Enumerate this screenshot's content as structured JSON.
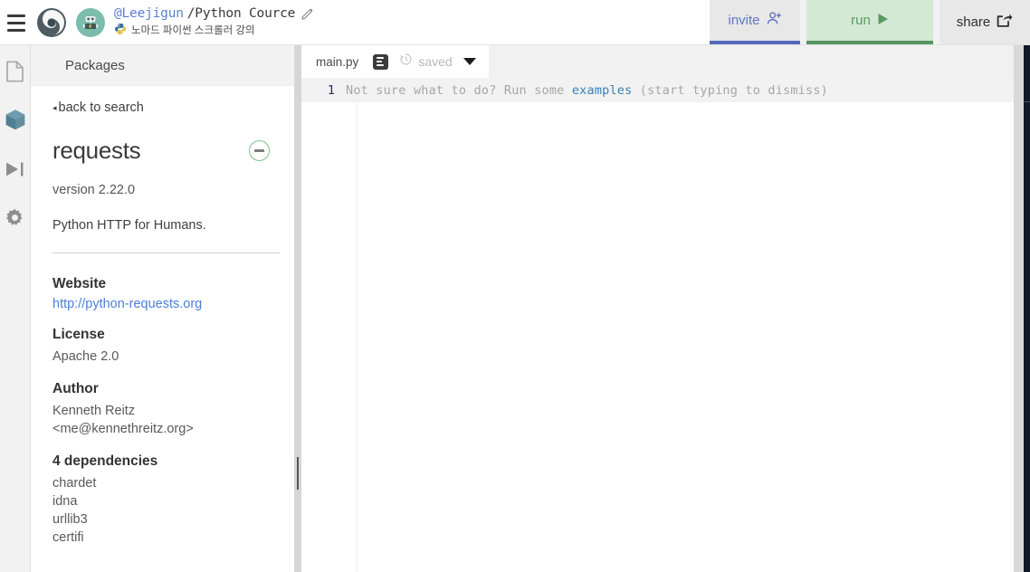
{
  "header": {
    "menu_icon": "hamburger-menu-icon",
    "logo_icon": "replit-logo-icon",
    "avatar_icon": "robot-avatar-icon",
    "owner": "@Leejigun",
    "repl_name": "/Python Cource",
    "edit_icon": "pencil-icon",
    "subtitle_icon": "python-logo-icon",
    "subtitle": "노마드 파이썬 스크롤러 강의",
    "buttons": {
      "invite": {
        "label": "invite",
        "icon": "add-person-icon",
        "accent": "#5568b8",
        "bg": "#e8e8e8"
      },
      "run": {
        "label": "run",
        "icon": "play-triangle-icon",
        "accent": "#56955e",
        "bg": "#d4e9d4"
      },
      "share": {
        "label": "share",
        "icon": "share-export-icon",
        "accent": "#2e2e2e",
        "bg": "#e8e8e8"
      }
    }
  },
  "rail": {
    "items": [
      {
        "name": "files",
        "icon": "file-document-icon",
        "active": false,
        "color": "#a8a8a8"
      },
      {
        "name": "packages",
        "icon": "package-cube-icon",
        "active": true,
        "color": "#5b8fa3"
      },
      {
        "name": "debugger",
        "icon": "play-to-end-icon",
        "active": false,
        "color": "#8e8e8e"
      },
      {
        "name": "settings",
        "icon": "gear-icon",
        "active": false,
        "color": "#8e8e8e"
      }
    ]
  },
  "packages": {
    "panel_title": "Packages",
    "back_label": "back to search",
    "back_caret": "◂",
    "name": "requests",
    "remove_icon": "minus-circle-icon",
    "version": "version 2.22.0",
    "description": "Python HTTP for Humans.",
    "meta": [
      {
        "heading": "Website",
        "value": "http://python-requests.org",
        "is_link": true
      },
      {
        "heading": "License",
        "value": "Apache 2.0",
        "is_link": false
      },
      {
        "heading": "Author",
        "value": "Kenneth Reitz\n<me@kennethreitz.org>",
        "is_link": false
      }
    ],
    "website_heading": "Website",
    "website_value": "http://python-requests.org",
    "license_heading": "License",
    "license_value": "Apache 2.0",
    "author_heading": "Author",
    "author_name": "Kenneth Reitz",
    "author_email": "<me@kennethreitz.org>",
    "dependencies_heading": "4 dependencies",
    "dependencies": [
      "chardet",
      "idna",
      "urllib3",
      "certifi"
    ]
  },
  "editor": {
    "tab_label": "main.py",
    "filelist_icon": "file-list-icon",
    "history_icon": "history-clock-icon",
    "save_status": "saved",
    "caret_icon": "chevron-down-icon",
    "line_number": "1",
    "hint_prefix": "Not sure what to do? Run some ",
    "hint_link": "examples",
    "hint_suffix": " (start typing to dismiss)"
  },
  "console": {
    "panel": "console-panel"
  }
}
